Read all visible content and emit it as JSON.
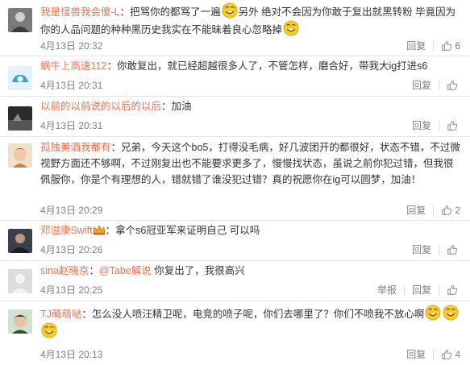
{
  "comments": [
    {
      "user": "我是怪兽我会傻-L",
      "before_emoji": "：把骂你的都骂了一遍",
      "after_emoji": "另外 绝对不会因为你敢于复出就黑转粉 毕竟因为你的人品问题的种种黑历史我实在不能昧着良心忽略掉",
      "time": "4月13日 20:32",
      "reply": "回复",
      "likes": "6"
    },
    {
      "user": "蜗牛上高速112",
      "text": "：你敢复出，就已经超越很多人了，不管怎样，磨合好，带我大ig打进s6",
      "time": "4月13日 20:31",
      "reply": "回复",
      "likes": ""
    },
    {
      "user": "以前的以前说的以后的以后",
      "text": "：加油",
      "time": "4月13日 20:31",
      "reply": "回复",
      "likes": ""
    },
    {
      "user": "孤独美酒我都有",
      "text": "：兄弟，今天这个bo5，打得没毛病，好几波团开的都很好，状态不错，不过微视野方面还不够啊，不过刚复出也不能要求更多了，慢慢找状态，虽说之前你犯过错，但我很佩服你，你是个有理想的人，错就错了谁没犯过错？真的祝愿你在ig可以圆梦，加油！",
      "time": "4月13日 20:29",
      "reply": "回复",
      "likes": "2"
    },
    {
      "user": "邓溢康Swift",
      "text": "：拿个s6冠亚军来证明自己 可以吗",
      "time": "4月13日 20:26",
      "reply": "回复",
      "likes": ""
    },
    {
      "user": "sina赵晓京",
      "mention": "@Tabe解说",
      "text": " 你复出了，我很高兴",
      "time": "4月13日 20:25",
      "report": "举报",
      "reply": "回复",
      "likes": ""
    },
    {
      "user": "TJ萌萌哒",
      "text": "：怎么没人喷汪精卫呢，电竞的喷子呢，你们去哪里了？你们不喷我不放心啊",
      "time": "4月13日 20:13",
      "reply": "回复",
      "likes": "4"
    }
  ]
}
